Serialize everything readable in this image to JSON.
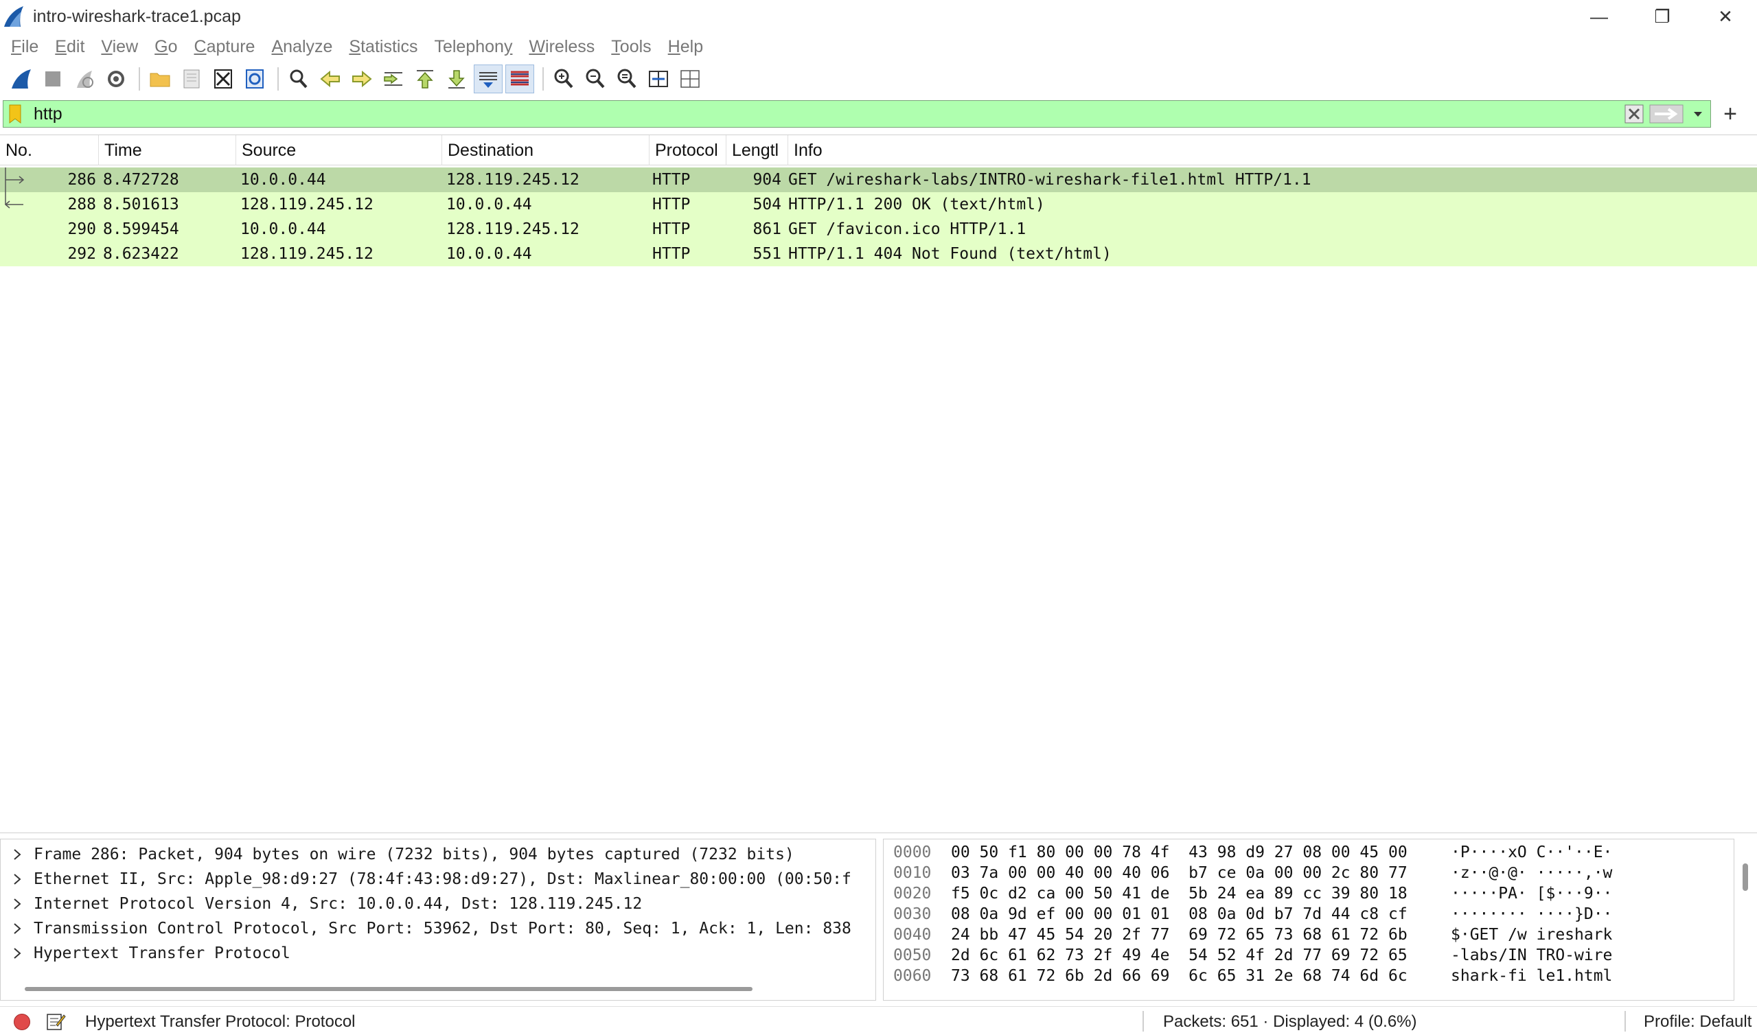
{
  "window": {
    "title": "intro-wireshark-trace1.pcap",
    "minimize_glyph": "—",
    "restore_glyph": "❐",
    "close_glyph": "✕"
  },
  "menu": [
    {
      "pre": "",
      "acc": "F",
      "post": "ile"
    },
    {
      "pre": "",
      "acc": "E",
      "post": "dit"
    },
    {
      "pre": "",
      "acc": "V",
      "post": "iew"
    },
    {
      "pre": "",
      "acc": "G",
      "post": "o"
    },
    {
      "pre": "",
      "acc": "C",
      "post": "apture"
    },
    {
      "pre": "",
      "acc": "A",
      "post": "nalyze"
    },
    {
      "pre": "",
      "acc": "S",
      "post": "tatistics"
    },
    {
      "pre": "Telephon",
      "acc": "y",
      "post": ""
    },
    {
      "pre": "",
      "acc": "W",
      "post": "ireless"
    },
    {
      "pre": "",
      "acc": "T",
      "post": "ools"
    },
    {
      "pre": "",
      "acc": "H",
      "post": "elp"
    }
  ],
  "filter": {
    "value": "http"
  },
  "packet_list": {
    "columns": [
      "No.",
      "Time",
      "Source",
      "Destination",
      "Protocol",
      "Lengtl",
      "Info"
    ],
    "rows": [
      {
        "no": "286",
        "time": "8.472728",
        "source": "10.0.0.44",
        "destination": "128.119.245.12",
        "protocol": "HTTP",
        "length": "904",
        "info": "GET /wireshark-labs/INTRO-wireshark-file1.html HTTP/1.1",
        "selected": true
      },
      {
        "no": "288",
        "time": "8.501613",
        "source": "128.119.245.12",
        "destination": "10.0.0.44",
        "protocol": "HTTP",
        "length": "504",
        "info": "HTTP/1.1 200 OK  (text/html)",
        "selected": false
      },
      {
        "no": "290",
        "time": "8.599454",
        "source": "10.0.0.44",
        "destination": "128.119.245.12",
        "protocol": "HTTP",
        "length": "861",
        "info": "GET /favicon.ico HTTP/1.1",
        "selected": false
      },
      {
        "no": "292",
        "time": "8.623422",
        "source": "128.119.245.12",
        "destination": "10.0.0.44",
        "protocol": "HTTP",
        "length": "551",
        "info": "HTTP/1.1 404 Not Found  (text/html)",
        "selected": false
      }
    ],
    "row_color": "#e4ffc7",
    "selected_color": "#bcd9a7"
  },
  "details": [
    "Frame 286: Packet, 904 bytes on wire (7232 bits), 904 bytes captured (7232 bits)",
    "Ethernet II, Src: Apple_98:d9:27 (78:4f:43:98:d9:27), Dst: Maxlinear_80:00:00 (00:50:f",
    "Internet Protocol Version 4, Src: 10.0.0.44, Dst: 128.119.245.12",
    "Transmission Control Protocol, Src Port: 53962, Dst Port: 80, Seq: 1, Ack: 1, Len: 838",
    "Hypertext Transfer Protocol"
  ],
  "bytes": [
    {
      "offset": "0000",
      "hex": "00 50 f1 80 00 00 78 4f  43 98 d9 27 08 00 45 00",
      "ascii": "·P····xO C··'··E·"
    },
    {
      "offset": "0010",
      "hex": "03 7a 00 00 40 00 40 06  b7 ce 0a 00 00 2c 80 77",
      "ascii": "·z··@·@· ·····,·w"
    },
    {
      "offset": "0020",
      "hex": "f5 0c d2 ca 00 50 41 de  5b 24 ea 89 cc 39 80 18",
      "ascii": "·····PA· [$···9··"
    },
    {
      "offset": "0030",
      "hex": "08 0a 9d ef 00 00 01 01  08 0a 0d b7 7d 44 c8 cf",
      "ascii": "········ ····}D··"
    },
    {
      "offset": "0040",
      "hex": "24 bb 47 45 54 20 2f 77  69 72 65 73 68 61 72 6b",
      "ascii": "$·GET /w ireshark"
    },
    {
      "offset": "0050",
      "hex": "2d 6c 61 62 73 2f 49 4e  54 52 4f 2d 77 69 72 65",
      "ascii": "-labs/IN TRO-wire"
    },
    {
      "offset": "0060",
      "hex": "73 68 61 72 6b 2d 66 69  6c 65 31 2e 68 74 6d 6c",
      "ascii": "shark-fi le1.html"
    }
  ],
  "status": {
    "field_text": "Hypertext Transfer Protocol: Protocol",
    "packets": "Packets: 651 · Displayed: 4 (0.6%)",
    "profile": "Profile: Default"
  },
  "colors": {
    "filter_valid": "#afffaf",
    "accent_blue": "#1f5fbf"
  }
}
